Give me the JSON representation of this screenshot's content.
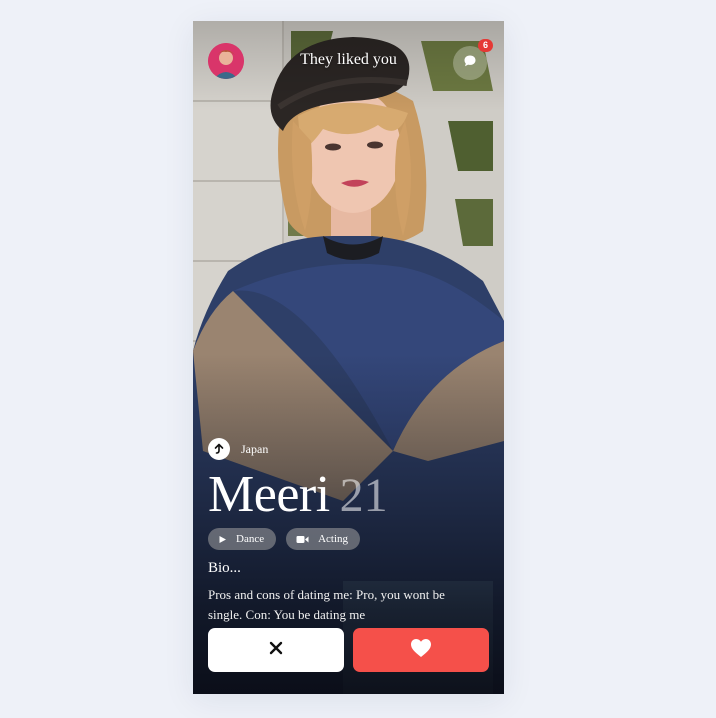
{
  "header": {
    "title": "They liked you",
    "message_count": "6",
    "avatar_icon": "user-avatar-icon",
    "chat_icon": "chat-bubble-icon"
  },
  "profile": {
    "location_icon": "arrow-up-location-icon",
    "location": "Japan",
    "name": "Meeri",
    "age": "21",
    "interests": [
      {
        "label": "Dance",
        "icon": "play-icon"
      },
      {
        "label": "Acting",
        "icon": "video-camera-icon"
      }
    ],
    "bio_title": "Bio...",
    "bio": "Pros and cons of dating me: Pro, you wont be single. Con: You be dating me"
  },
  "actions": {
    "pass_icon": "close-icon",
    "like_icon": "heart-icon"
  },
  "colors": {
    "background": "#eef1f8",
    "like": "#f5504a",
    "pass": "#ffffff",
    "badge": "#e53935",
    "avatar": "#d9356a"
  }
}
